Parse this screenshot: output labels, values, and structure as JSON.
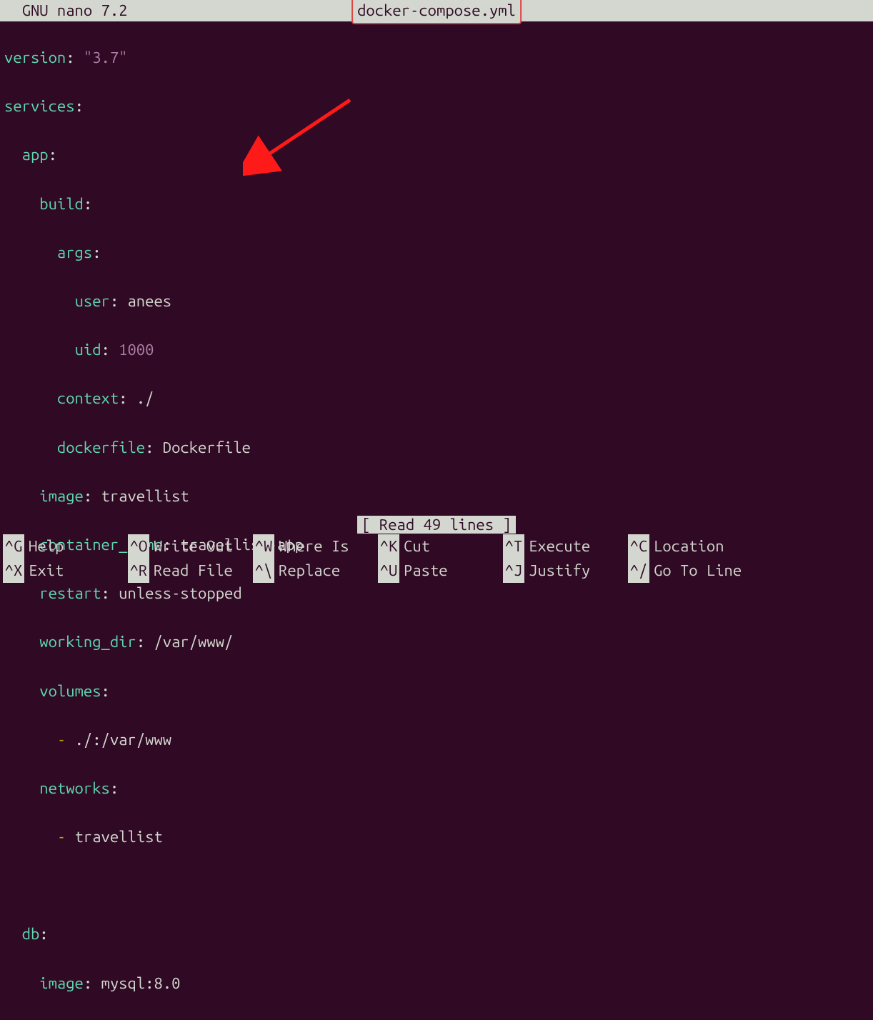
{
  "titlebar": {
    "app": "  GNU nano 7.2",
    "filename": "docker-compose.yml"
  },
  "yaml": {
    "l1_key": "version",
    "l1_val": "\"3.7\"",
    "l2_key": "services",
    "l3_key": "app",
    "l4_key": "build",
    "l5_key": "args",
    "l6_key": "user",
    "l6_val": "anees",
    "l7_key": "uid",
    "l7_val": "1000",
    "l8_key": "context",
    "l8_val": "./",
    "l9_key": "dockerfile",
    "l9_val": "Dockerfile",
    "l10_key": "image",
    "l10_val": "travellist",
    "l11_key": "container_name",
    "l11_val": "travellist-app",
    "l12_key": "restart",
    "l12_val": "unless-stopped",
    "l13_key": "working_dir",
    "l13_val": "/var/www/",
    "l14_key": "volumes",
    "l15_val": "./:/var/www",
    "l16_key": "networks",
    "l17_val": "travellist",
    "l18_key": "db",
    "l19_key": "image",
    "l19_val": "mysql:8.0"
  },
  "status": "[ Read 49 lines ]",
  "shortcuts": {
    "row1": [
      {
        "k": "^G",
        "l": "Help"
      },
      {
        "k": "^O",
        "l": "Write Out"
      },
      {
        "k": "^W",
        "l": "Where Is"
      },
      {
        "k": "^K",
        "l": "Cut"
      },
      {
        "k": "^T",
        "l": "Execute"
      },
      {
        "k": "^C",
        "l": "Location"
      }
    ],
    "row2": [
      {
        "k": "^X",
        "l": "Exit"
      },
      {
        "k": "^R",
        "l": "Read File"
      },
      {
        "k": "^\\",
        "l": "Replace"
      },
      {
        "k": "^U",
        "l": "Paste"
      },
      {
        "k": "^J",
        "l": "Justify"
      },
      {
        "k": "^/",
        "l": "Go To Line"
      }
    ]
  }
}
